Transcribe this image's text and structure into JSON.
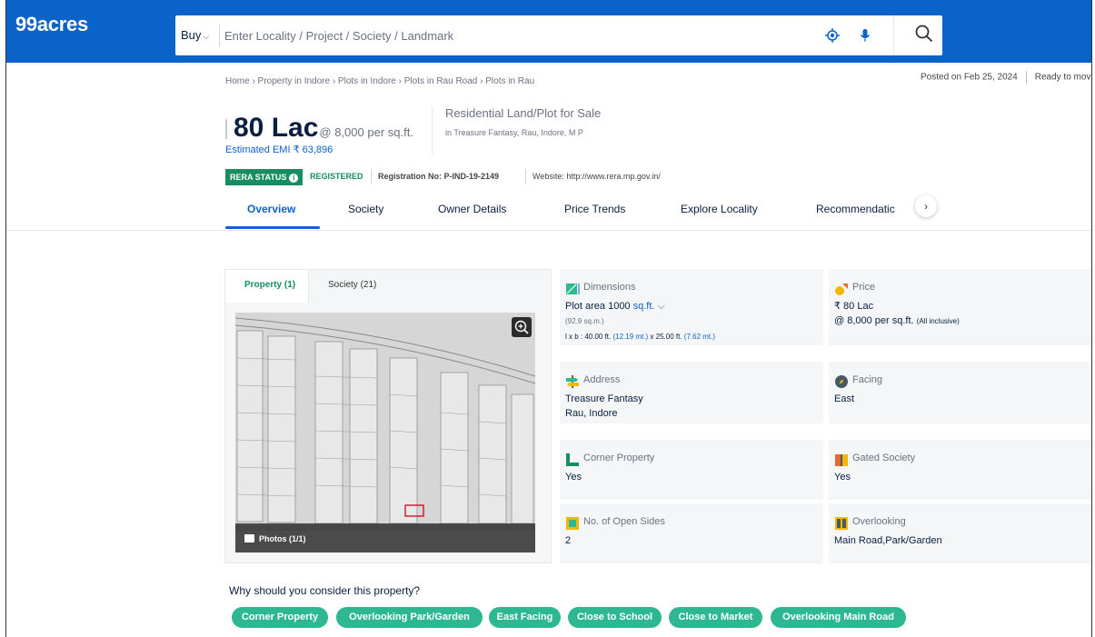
{
  "header": {
    "logo": "99acres",
    "buy_label": "Buy",
    "search_placeholder": "Enter Locality / Project / Society / Landmark"
  },
  "breadcrumb": "Home › Property in Indore › Plots in Indore › Plots in Rau Road › Plots in Rau",
  "posted": {
    "date": "Posted on Feb 25, 2024",
    "status": "Ready to move"
  },
  "listing": {
    "price": "80 Lac",
    "price_per_sqft": "@ 8,000 per sq.ft.",
    "emi": "Estimated EMI ₹ 63,896",
    "type": "Residential Land/Plot for Sale",
    "location": "in Treasure Fantasy, Rau, Indore, M P"
  },
  "rera": {
    "badge": "RERA STATUS",
    "status": "REGISTERED",
    "registration": "Registration No: P-IND-19-2149",
    "website": "Website: http://www.rera.mp.gov.in/"
  },
  "tabs": [
    {
      "label": "Overview",
      "active": true
    },
    {
      "label": "Society"
    },
    {
      "label": "Owner Details"
    },
    {
      "label": "Price Trends"
    },
    {
      "label": "Explore Locality"
    },
    {
      "label": "Recommendatic"
    }
  ],
  "photo_card": {
    "tabs": [
      {
        "label": "Property (1)"
      },
      {
        "label": "Society (21)"
      }
    ],
    "photos_label": "Photos (1/1)"
  },
  "details": {
    "dimensions": {
      "title": "Dimensions",
      "plot_area": "Plot area 1000",
      "unit": "sq.ft.",
      "sqm": "(92.9 sq.m.)",
      "lxb_prefix": "l x b : 40.00 ft.",
      "lxb_m1": "(12.19 mt.)",
      "lxb_mid": "x 25.00 ft.",
      "lxb_m2": "(7.62 mt.)"
    },
    "price": {
      "title": "Price",
      "value": "₹ 80 Lac",
      "per": "@ 8,000 per sq.ft.",
      "note": "(All inclusive)"
    },
    "address": {
      "title": "Address",
      "line1": "Treasure Fantasy",
      "line2": "Rau, Indore"
    },
    "facing": {
      "title": "Facing",
      "value": "East"
    },
    "corner": {
      "title": "Corner Property",
      "value": "Yes"
    },
    "gated": {
      "title": "Gated Society",
      "value": "Yes"
    },
    "open_sides": {
      "title": "No. of Open Sides",
      "value": "2"
    },
    "overlooking": {
      "title": "Overlooking",
      "value": "Main Road,Park/Garden"
    }
  },
  "why": {
    "title": "Why should you consider this property?",
    "chips": [
      "Corner Property",
      "Overlooking Park/Garden",
      "East Facing",
      "Close to School",
      "Close to Market",
      "Overlooking Main Road"
    ]
  },
  "colors": {
    "brand_blue": "#0A63C9",
    "rera_green": "#168D62",
    "chip_green": "#2DB891"
  }
}
